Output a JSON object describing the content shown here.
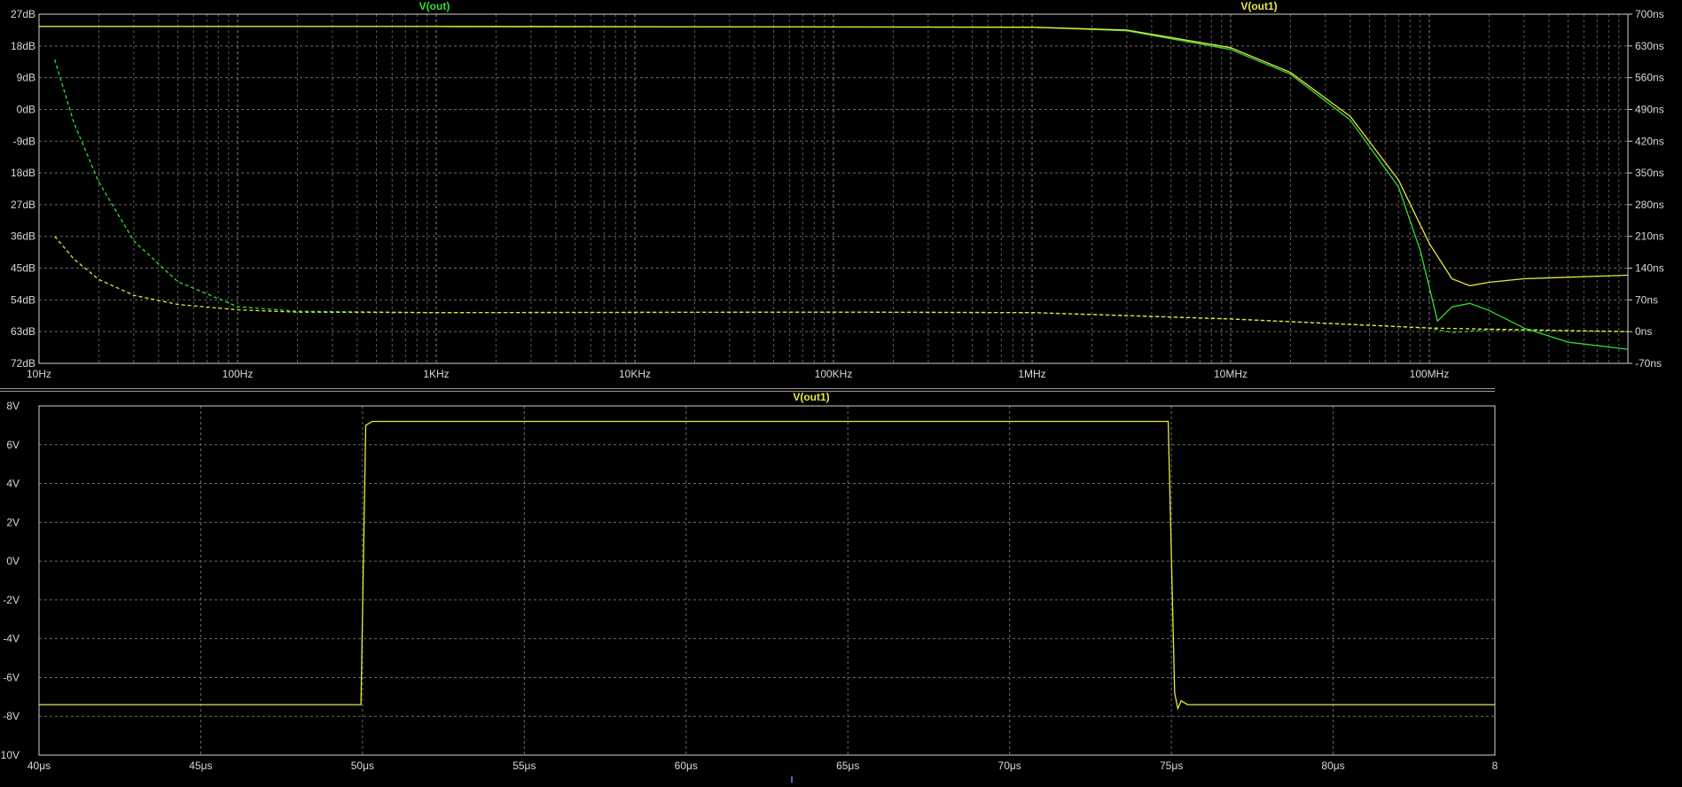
{
  "top_plot": {
    "left_axis_ticks": [
      "27dB",
      "18dB",
      "9dB",
      "0dB",
      "-9dB",
      "18dB",
      "27dB",
      "36dB",
      "45dB",
      "54dB",
      "63dB",
      "72dB"
    ],
    "right_axis_ticks": [
      "700ns",
      "630ns",
      "560ns",
      "490ns",
      "420ns",
      "350ns",
      "280ns",
      "210ns",
      "140ns",
      "70ns",
      "0ns",
      "-70ns"
    ],
    "x_axis_ticks": [
      "10Hz",
      "100Hz",
      "1KHz",
      "10KHz",
      "100KHz",
      "1MHz",
      "10MHz",
      "100MHz"
    ],
    "trace_labels": [
      {
        "text": "V(out)",
        "color": "#33dd33"
      },
      {
        "text": "V(out1)",
        "color": "#e8e840"
      }
    ]
  },
  "bottom_plot": {
    "y_axis_ticks": [
      "8V",
      "6V",
      "4V",
      "2V",
      "0V",
      "-2V",
      "-4V",
      "-6V",
      "-8V",
      "10V"
    ],
    "x_axis_ticks": [
      "40μs",
      "45μs",
      "50μs",
      "55μs",
      "60μs",
      "65μs",
      "70μs",
      "75μs",
      "80μs",
      "8"
    ],
    "trace_label": {
      "text": "V(out1)",
      "color": "#e8e840"
    }
  },
  "chart_data": [
    {
      "type": "line",
      "xscale": "log",
      "xlim": [
        10,
        1000000000
      ],
      "ylim": [
        -72,
        27
      ],
      "y2lim": [
        -70,
        700
      ],
      "xlabel": "",
      "ylabel": "",
      "grid": true,
      "series": [
        {
          "name": "V(out)",
          "color": "#33dd33",
          "style": "solid",
          "axis": "left",
          "x": [
            10,
            1000,
            1000000,
            3000000,
            10000000,
            20000000,
            40000000,
            70000000,
            90000000,
            110000000,
            130000000,
            160000000,
            200000000,
            300000000,
            500000000,
            1000000000
          ],
          "y": [
            23.5,
            23.5,
            23.3,
            22.3,
            17,
            10,
            -3,
            -22,
            -40,
            -60,
            -56,
            -55,
            -57,
            -62,
            -66,
            -68
          ]
        },
        {
          "name": "V(out1)",
          "color": "#e8e840",
          "style": "solid",
          "axis": "left",
          "x": [
            10,
            1000,
            1000000,
            3000000,
            10000000,
            20000000,
            40000000,
            70000000,
            100000000,
            130000000,
            160000000,
            200000000,
            300000000,
            1000000000
          ],
          "y": [
            23.5,
            23.5,
            23.3,
            22.5,
            17.5,
            10.5,
            -2,
            -20,
            -38,
            -48,
            -50,
            -49,
            -48,
            -47
          ]
        },
        {
          "name": "V(out)",
          "color": "#33dd33",
          "style": "dashed",
          "axis": "right",
          "x": [
            12,
            15,
            20,
            30,
            50,
            100,
            200,
            1000,
            100000,
            1000000,
            10000000,
            100000000,
            130000000,
            200000000,
            1000000000
          ],
          "y": [
            600,
            460,
            330,
            200,
            110,
            55,
            45,
            42,
            43,
            42,
            28,
            8,
            -2,
            4,
            0
          ]
        },
        {
          "name": "V(out1)",
          "color": "#e8e840",
          "style": "dashed",
          "axis": "right",
          "x": [
            12,
            15,
            20,
            30,
            50,
            100,
            200,
            1000,
            100000,
            1000000,
            10000000,
            100000000,
            1000000000
          ],
          "y": [
            210,
            160,
            115,
            80,
            60,
            48,
            43,
            42,
            43,
            42,
            28,
            8,
            0
          ]
        }
      ]
    },
    {
      "type": "line",
      "xlim": [
        40,
        85
      ],
      "ylim": [
        -10,
        8
      ],
      "xlabel": "",
      "ylabel": "",
      "grid": true,
      "series": [
        {
          "name": "V(out1)",
          "color": "#e8e840",
          "x": [
            40,
            49.95,
            50.1,
            50.3,
            74.9,
            75.1,
            75.2,
            75.3,
            75.5,
            85
          ],
          "y": [
            -7.4,
            -7.4,
            7.0,
            7.2,
            7.2,
            -6.8,
            -7.6,
            -7.2,
            -7.4,
            -7.4
          ]
        }
      ]
    }
  ]
}
